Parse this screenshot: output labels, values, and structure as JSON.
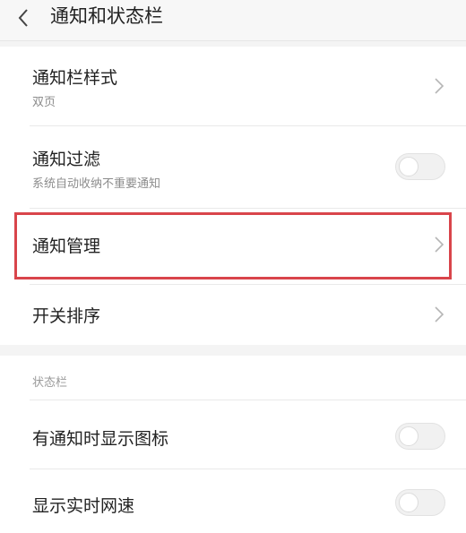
{
  "header": {
    "title": "通知和状态栏",
    "back_icon": "chevron-left-icon"
  },
  "notification_section": {
    "items": [
      {
        "title": "通知栏样式",
        "subtitle": "双页",
        "control": "chevron-right-icon"
      },
      {
        "title": "通知过滤",
        "subtitle": "系统自动收纳不重要通知",
        "control": "toggle",
        "enabled": false
      },
      {
        "title": "通知管理",
        "control": "chevron-right-icon",
        "highlighted": true
      },
      {
        "title": "开关排序",
        "control": "chevron-right-icon"
      }
    ]
  },
  "status_bar_section": {
    "header": "状态栏",
    "items": [
      {
        "title": "有通知时显示图标",
        "control": "toggle",
        "enabled": false
      },
      {
        "title": "显示实时网速",
        "control": "toggle",
        "enabled": false
      }
    ]
  },
  "colors": {
    "highlight_border": "#d9454b",
    "background": "#f4f4f4",
    "card": "#ffffff"
  }
}
